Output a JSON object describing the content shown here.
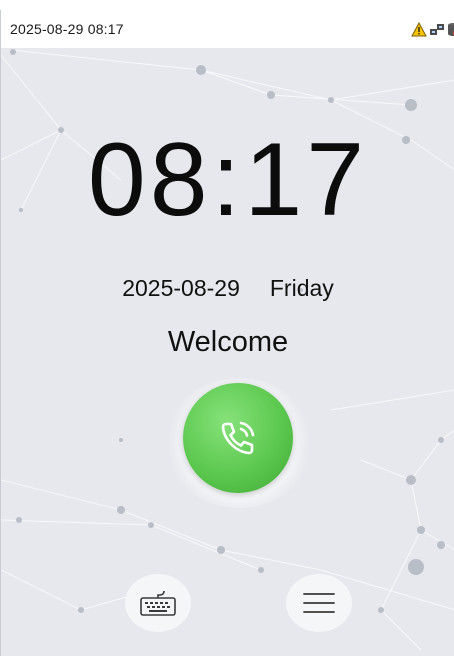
{
  "status_bar": {
    "datetime": "2025-08-29 08:17",
    "icons": [
      "warning-icon",
      "network-icon",
      "server-icon"
    ]
  },
  "clock": {
    "time": "08:17",
    "date": "2025-08-29",
    "weekday": "Friday"
  },
  "greeting": "Welcome",
  "buttons": {
    "call": "phone-call-icon",
    "keyboard": "keyboard-icon",
    "menu": "menu-icon"
  },
  "colors": {
    "call_green": "#5cc84f",
    "warning_yellow": "#f5c400",
    "server_red": "#e03a2f",
    "background": "#e6e8ed"
  }
}
